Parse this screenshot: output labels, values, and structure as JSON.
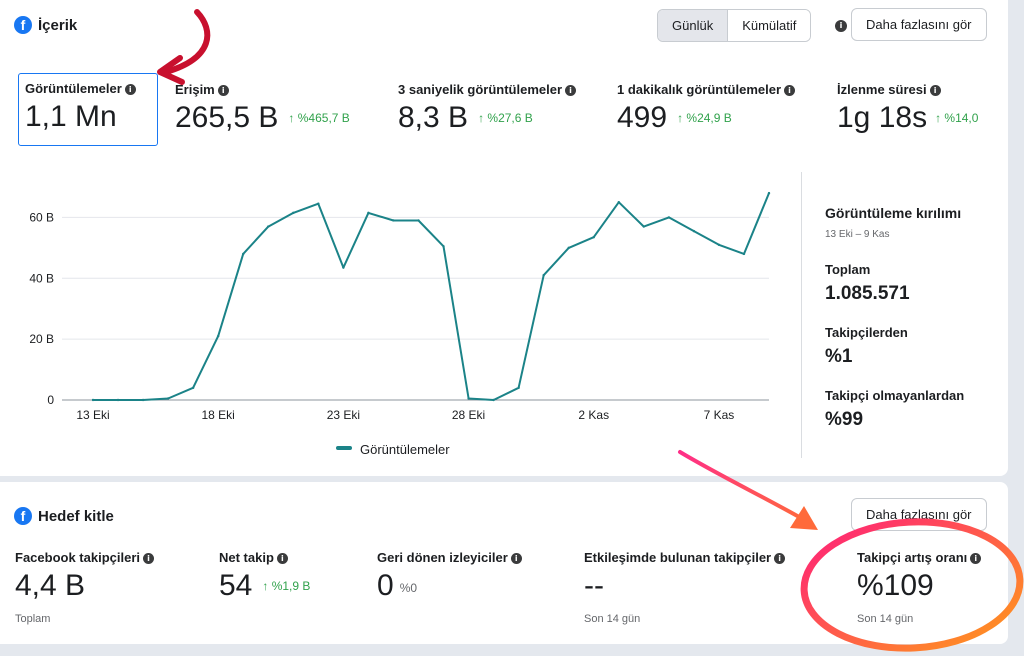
{
  "content": {
    "title": "İçerik",
    "tabs": [
      {
        "label": "Günlük",
        "active": true
      },
      {
        "label": "Kümülatif",
        "active": false
      }
    ],
    "more_button": "Daha fazlasını gör",
    "metrics": [
      {
        "label": "Görüntülemeler",
        "value": "1,1 Mn",
        "delta": "",
        "selected": true
      },
      {
        "label": "Erişim",
        "value": "265,5 B",
        "delta": "↑ %465,7 B"
      },
      {
        "label": "3 saniyelik görüntülemeler",
        "value": "8,3 B",
        "delta": "↑ %27,6 B"
      },
      {
        "label": "1 dakikalık görüntülemeler",
        "value": "499",
        "delta": "↑ %24,9 B"
      },
      {
        "label": "İzlenme süresi",
        "value": "1g 18s",
        "delta": "↑ %14,0"
      }
    ],
    "breakdown": {
      "title": "Görüntüleme kırılımı",
      "date_range": "13 Eki – 9 Kas",
      "items": [
        {
          "label": "Toplam",
          "value": "1.085.571"
        },
        {
          "label": "Takipçilerden",
          "value": "%1"
        },
        {
          "label": "Takipçi olmayanlardan",
          "value": "%99"
        }
      ]
    }
  },
  "chart_data": {
    "type": "line",
    "x": [
      "13 Eki",
      "14 Eki",
      "15 Eki",
      "16 Eki",
      "17 Eki",
      "18 Eki",
      "19 Eki",
      "20 Eki",
      "21 Eki",
      "22 Eki",
      "23 Eki",
      "24 Eki",
      "25 Eki",
      "26 Eki",
      "27 Eki",
      "28 Eki",
      "29 Eki",
      "30 Eki",
      "31 Eki",
      "1 Kas",
      "2 Kas",
      "3 Kas",
      "4 Kas",
      "5 Kas",
      "6 Kas",
      "7 Kas",
      "8 Kas",
      "9 Kas"
    ],
    "x_tick_labels": [
      "13 Eki",
      "18 Eki",
      "23 Eki",
      "28 Eki",
      "2 Kas",
      "7 Kas"
    ],
    "x_tick_indices": [
      0,
      5,
      10,
      15,
      20,
      25
    ],
    "series": [
      {
        "name": "Görüntülemeler",
        "color": "#1b8388",
        "values": [
          0,
          0,
          0,
          0.5,
          4,
          21,
          48,
          57,
          61.5,
          64.5,
          43.5,
          61.5,
          59,
          59,
          50.5,
          0.5,
          0,
          4,
          41,
          50,
          53.5,
          65,
          57,
          60,
          55.5,
          51,
          48,
          68
        ]
      }
    ],
    "y_ticks": [
      0,
      20,
      40,
      60
    ],
    "y_tick_labels": [
      "0",
      "20 B",
      "40 B",
      "60 B"
    ],
    "ylim": [
      0,
      70
    ],
    "grid": true,
    "legend": "bottom-center"
  },
  "audience": {
    "title": "Hedef kitle",
    "more_button": "Daha fazlasını gör",
    "metrics": [
      {
        "label": "Facebook takipçileri",
        "value": "4,4 B",
        "delta": "",
        "sub": "Toplam"
      },
      {
        "label": "Net takip",
        "value": "54",
        "delta": "↑ %1,9 B",
        "sub": ""
      },
      {
        "label": "Geri dönen izleyiciler",
        "value": "0",
        "delta_muted": "%0",
        "sub": ""
      },
      {
        "label": "Etkileşimde bulunan takipçiler",
        "value": "--",
        "delta": "",
        "sub": "Son 14 gün"
      },
      {
        "label": "Takipçi artış oranı",
        "value": "%109",
        "delta": "",
        "sub": "Son 14 gün"
      }
    ]
  },
  "icons": {
    "brand": "facebook-icon",
    "info": "info-icon"
  },
  "colors": {
    "accent": "#1877f2",
    "positive": "#31a24c",
    "line": "#1b8388",
    "annotation_red": "#c8102e",
    "annotation_gradient": [
      "#ff2e88",
      "#ff8a00"
    ]
  }
}
